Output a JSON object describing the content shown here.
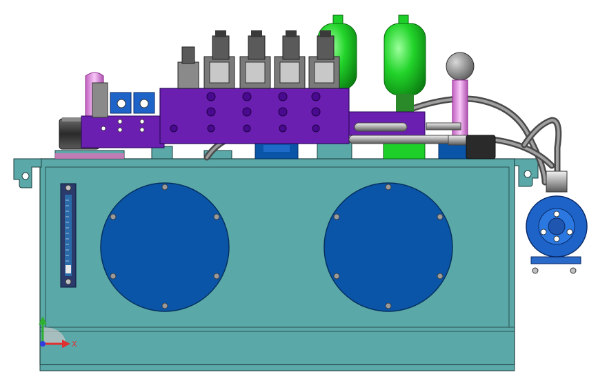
{
  "viewport": {
    "background": "#ffffff",
    "colors": {
      "tank": "#5aa8a8",
      "tank_stroke": "#1e3c3c",
      "cover": "#0a55a8",
      "manifold": "#6a1fb0",
      "accumulator": "#1ecf2a",
      "pump": "#1e64c8",
      "hose": "#7a7a7a",
      "steel": "#c8c8c8",
      "pink": "#e8a0e8",
      "dark": "#3a3a3a"
    },
    "triad": {
      "x_label": "X",
      "x_color": "#e03030",
      "y_color": "#30b030",
      "z_color": "#3040e0"
    }
  }
}
